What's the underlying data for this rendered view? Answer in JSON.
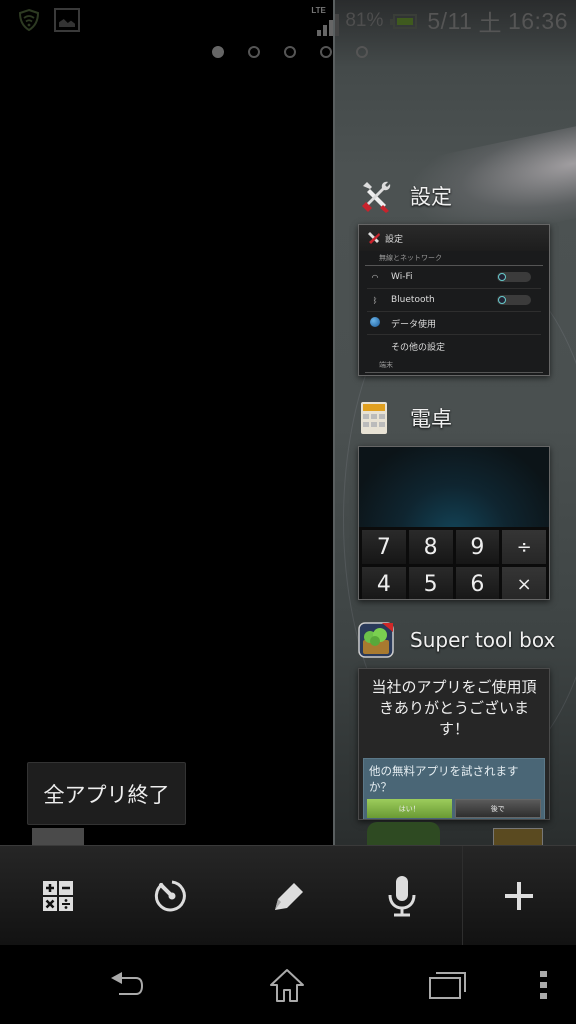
{
  "status_bar": {
    "network_type": "LTE",
    "battery_percent": "81%",
    "date": "5/11",
    "weekday": "土",
    "time": "16:36",
    "left_icons": [
      "security-shield-icon",
      "gallery-icon"
    ],
    "signal_strength": 3
  },
  "home_pages": {
    "count": 5,
    "active_index": 0
  },
  "recent_apps": [
    {
      "name": "設定",
      "icon": "tools-icon",
      "thumbnail": {
        "title": "設定",
        "section": "無線とネットワーク",
        "rows": [
          {
            "icon": "wifi-icon",
            "label": "Wi-Fi",
            "toggle": "off"
          },
          {
            "icon": "bluetooth-icon",
            "label": "Bluetooth",
            "toggle": "off"
          },
          {
            "icon": "data-usage-icon",
            "label": "データ使用"
          },
          {
            "icon": "",
            "label": "その他の設定"
          }
        ],
        "section2": "端末"
      }
    },
    {
      "name": "電卓",
      "icon": "calculator-icon",
      "thumbnail": {
        "keys": [
          "7",
          "8",
          "9",
          "÷",
          "4",
          "5",
          "6",
          "×"
        ]
      }
    },
    {
      "name": "Super tool box",
      "icon": "super-tool-box-icon",
      "thumbnail": {
        "message": "当社のアプリをご使用頂きありがとうございます！",
        "question": "他の無料アプリを試されますか？",
        "yes_label": "はい！",
        "later_label": "後で"
      }
    }
  ],
  "close_all_button": {
    "label": "全アプリ終了"
  },
  "small_apps": [
    {
      "name": "calculator",
      "icon": "calculator-small-app-icon"
    },
    {
      "name": "timer",
      "icon": "timer-icon"
    },
    {
      "name": "note",
      "icon": "pencil-icon"
    },
    {
      "name": "voice-recorder",
      "icon": "microphone-icon"
    },
    {
      "name": "add",
      "icon": "plus-icon"
    }
  ],
  "nav_bar": {
    "buttons": [
      "back",
      "home",
      "recent-apps",
      "menu"
    ]
  },
  "colors": {
    "status_text": "#555555",
    "battery_fill": "#3f5a1e",
    "yes_button": "#8cbc4c",
    "prompt_bg": "#4a6676"
  }
}
